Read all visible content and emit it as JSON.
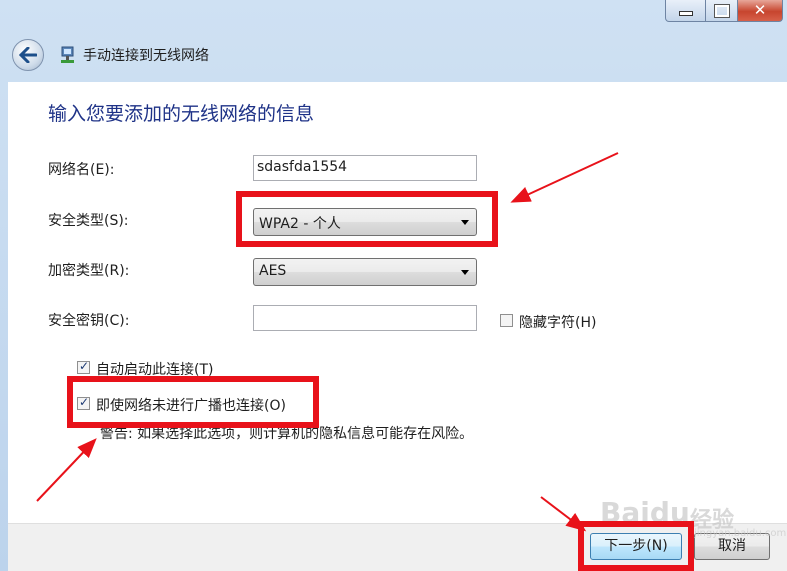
{
  "window": {
    "title": "手动连接到无线网络",
    "controls": {
      "minimize_icon": "minimize-icon",
      "maximize_icon": "maximize-icon",
      "close_icon": "close-icon"
    }
  },
  "heading": "输入您要添加的无线网络的信息",
  "form": {
    "network_name": {
      "label": "网络名(E):",
      "value": "sdasfda1554"
    },
    "security_type": {
      "label": "安全类型(S):",
      "selected": "WPA2 - 个人"
    },
    "encryption_type": {
      "label": "加密类型(R):",
      "selected": "AES"
    },
    "security_key": {
      "label": "安全密钥(C):",
      "value": ""
    },
    "hide_characters": {
      "label": "隐藏字符(H)",
      "checked": false
    },
    "auto_start": {
      "label": "自动启动此连接(T)",
      "checked": true
    },
    "connect_hidden": {
      "label": "即使网络未进行广播也连接(O)",
      "checked": true
    },
    "warning": "警告: 如果选择此选项，则计算机的隐私信息可能存在风险。"
  },
  "buttons": {
    "next": "下一步(N)",
    "cancel": "取消"
  },
  "watermark": {
    "brand": "Baidu",
    "suffix": "经验",
    "url": "jingyan.baidu.com"
  },
  "colors": {
    "annotation_red": "#e8121a",
    "heading_blue": "#1e3287"
  }
}
